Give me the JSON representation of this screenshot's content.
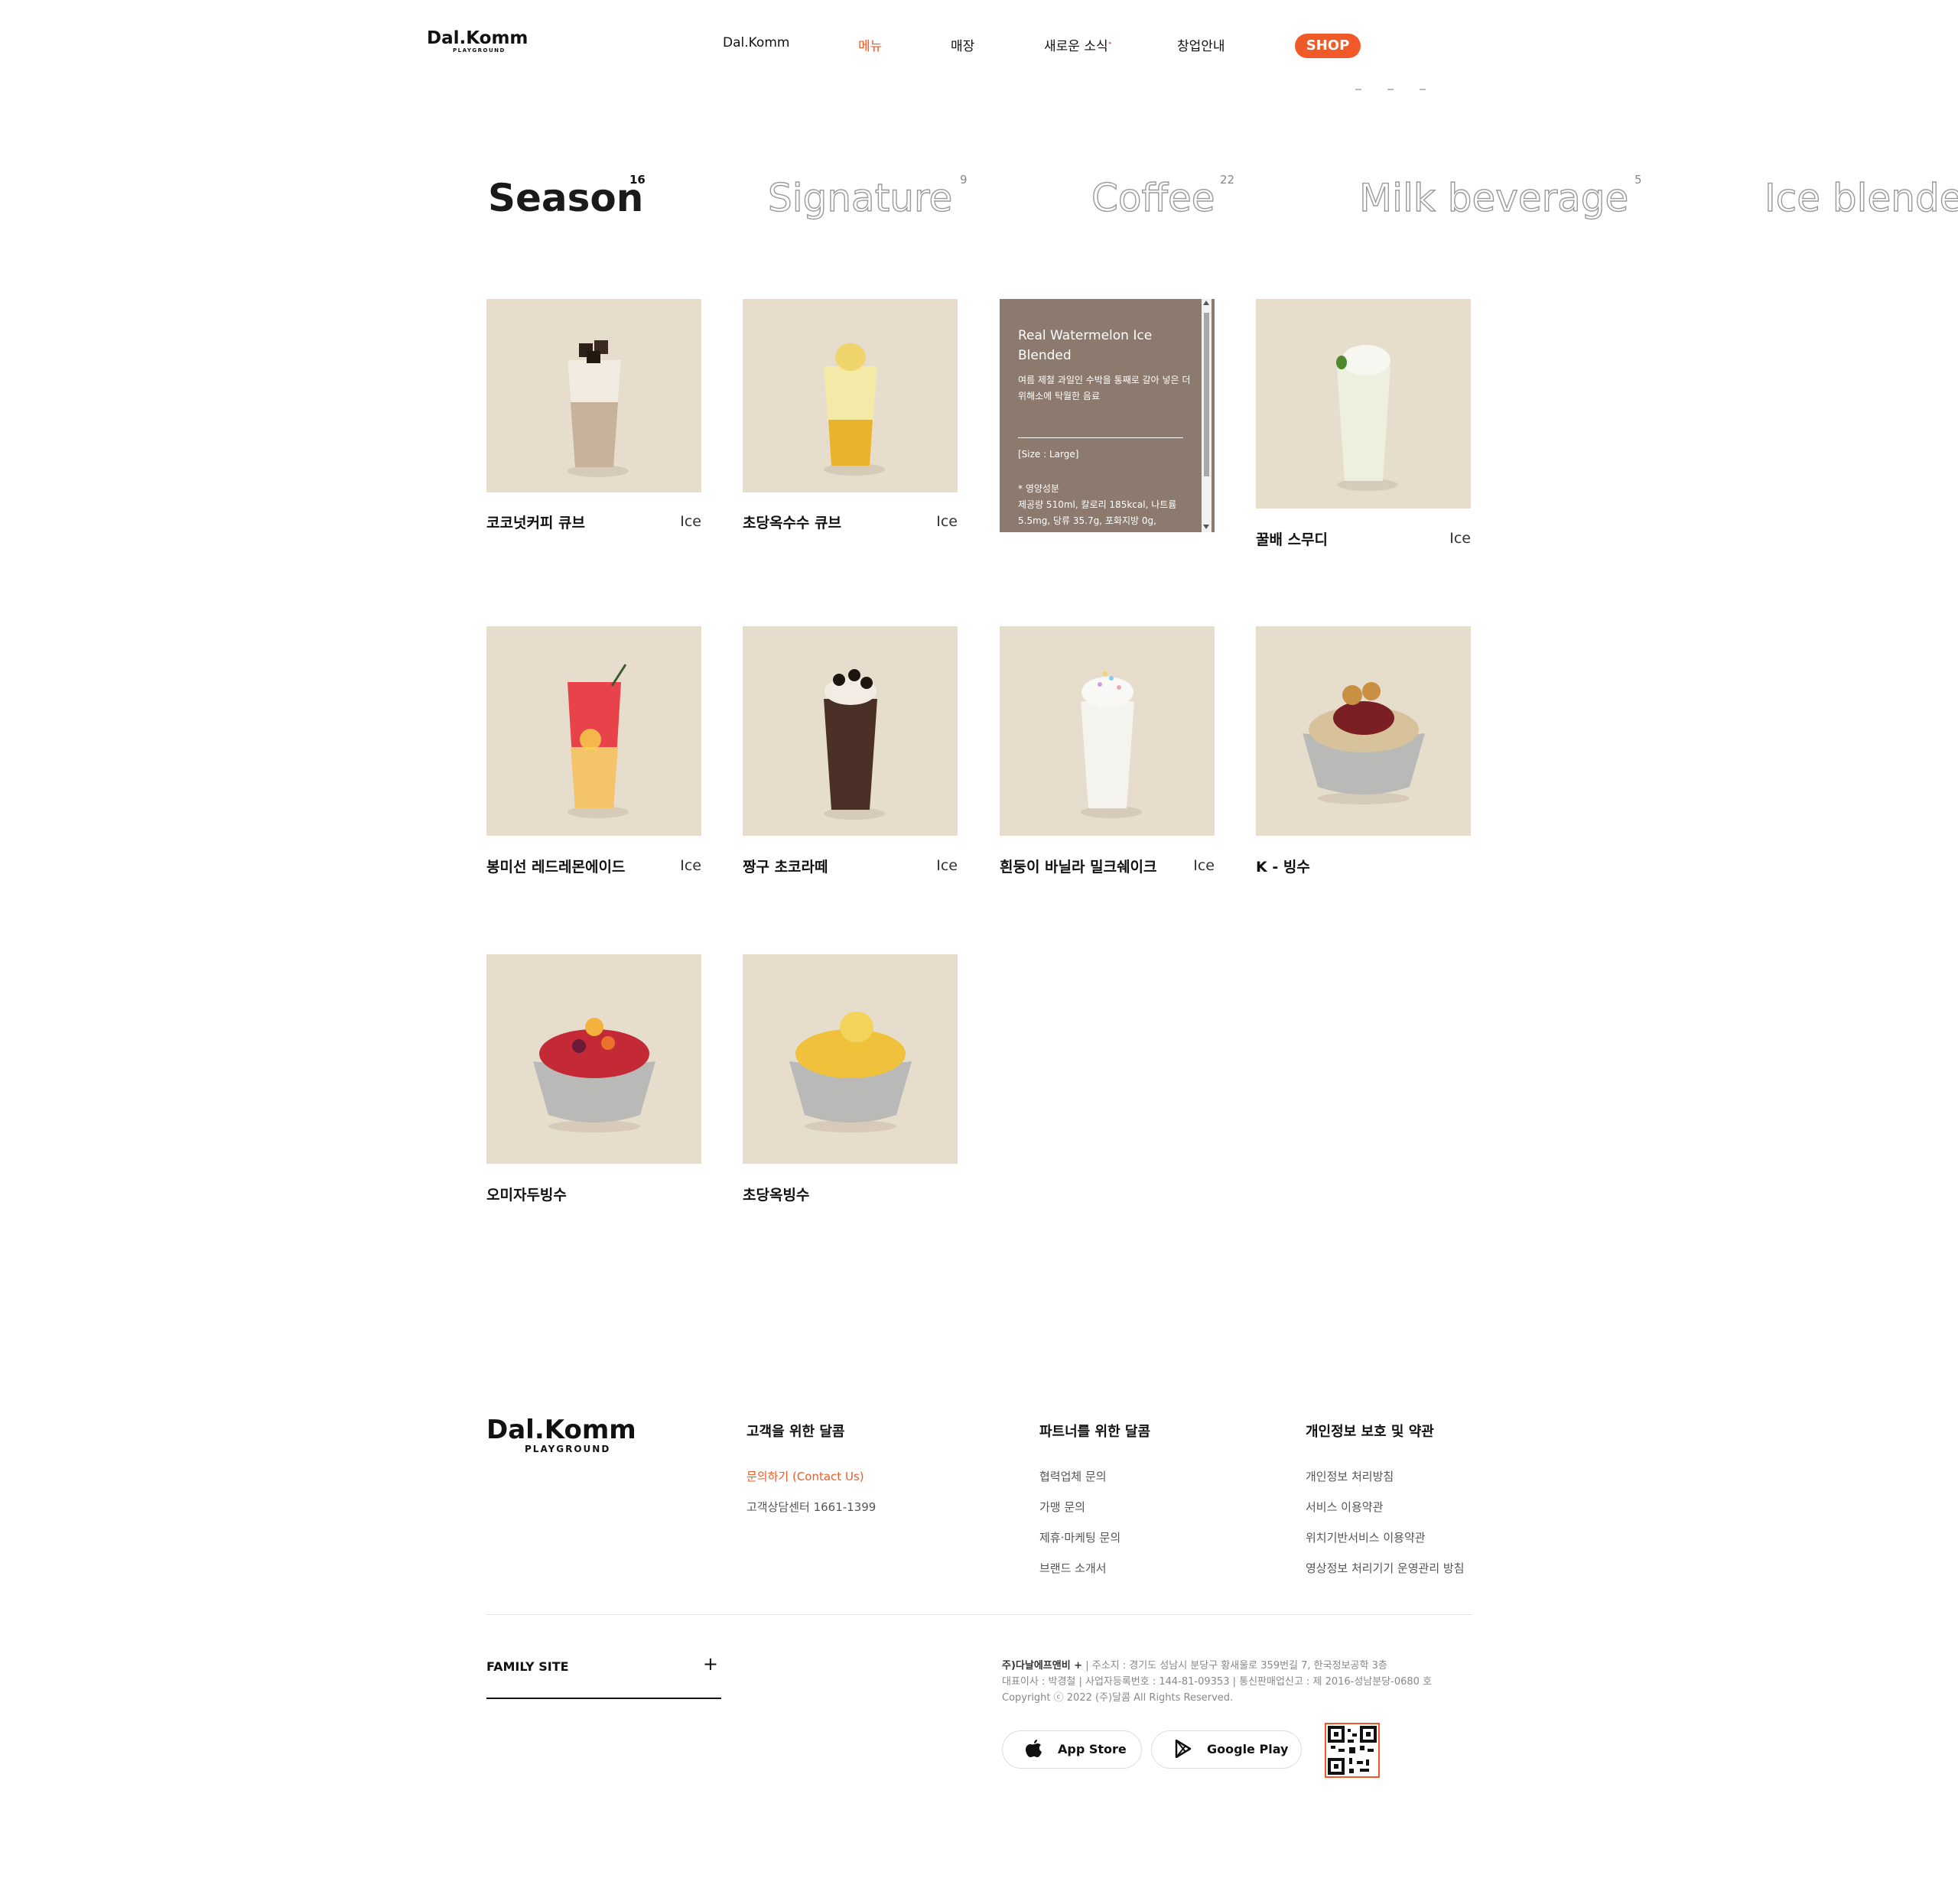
{
  "header": {
    "logo_word": "Dal.Komm",
    "logo_sub": "PLAYGROUND",
    "nav": [
      {
        "label": "Dal.Komm"
      },
      {
        "label": "메뉴"
      },
      {
        "label": "매장"
      },
      {
        "label": "새로운 소식"
      },
      {
        "label": "창업안내"
      }
    ],
    "shop_label": "SHOP"
  },
  "tabs": [
    {
      "label": "Season",
      "count": "16"
    },
    {
      "label": "Signature",
      "count": "9"
    },
    {
      "label": "Coffee",
      "count": "22"
    },
    {
      "label": "Milk beverage",
      "count": "5"
    },
    {
      "label": "Ice blende",
      "count": ""
    }
  ],
  "products": [
    {
      "name": "코코넛커피 큐브",
      "tag": "Ice"
    },
    {
      "name": "초당옥수수 큐브",
      "tag": "Ice"
    },
    {
      "name": "",
      "tag": ""
    },
    {
      "name": "꿀배 스무디",
      "tag": "Ice"
    },
    {
      "name": "봉미선 레드레몬에이드",
      "tag": "Ice"
    },
    {
      "name": "짱구 초코라떼",
      "tag": "Ice"
    },
    {
      "name": "흰둥이 바닐라 밀크쉐이크",
      "tag": "Ice"
    },
    {
      "name": "K - 빙수",
      "tag": ""
    },
    {
      "name": "오미자두빙수",
      "tag": ""
    },
    {
      "name": "초당옥빙수",
      "tag": ""
    }
  ],
  "overlay": {
    "title": "Real Watermelon Ice Blended",
    "desc": "여름 제철 과일인 수박을 통째로 갈아 넣은 더위해소에 탁월한 음료",
    "size": "[Size : Large]",
    "nutri_head": "* 영양성분",
    "nutri": "제공량 510ml, 칼로리 185kcal, 나트륨 5.5mg, 당류 35.7g, 포화지방 0g,"
  },
  "footer": {
    "logo_word": "Dal.Komm",
    "logo_sub": "PLAYGROUND",
    "col1": {
      "head": "고객을 위한 달콤",
      "links": [
        "문의하기 (Contact Us)",
        "고객상담센터 1661-1399"
      ]
    },
    "col2": {
      "head": "파트너를 위한 달콤",
      "links": [
        "협력업체 문의",
        "가맹 문의",
        "제휴·마케팅 문의",
        "브랜드 소개서"
      ]
    },
    "col3": {
      "head": "개인정보 보호 및 약관",
      "links": [
        "개인정보 처리방침",
        "서비스 이용약관",
        "위치기반서비스 이용약관",
        "영상정보 처리기기 운영관리 방침"
      ]
    },
    "family_site": "FAMILY SITE",
    "company": "주)다날에프앤비 +",
    "address": " | 주소지 : 경기도 성남시 분당구 황새울로 359번길 7, 한국정보공학 3층",
    "reg": "대표이사 : 박경철 | 사업자등록번호 : 144-81-09353 | 통신판매업신고 : 제 2016-성남분당-0680 호",
    "copyright": "Copyright ⓒ 2022 (주)달콤 All Rights Reserved.",
    "app_store": "App Store",
    "google_play": "Google Play"
  }
}
